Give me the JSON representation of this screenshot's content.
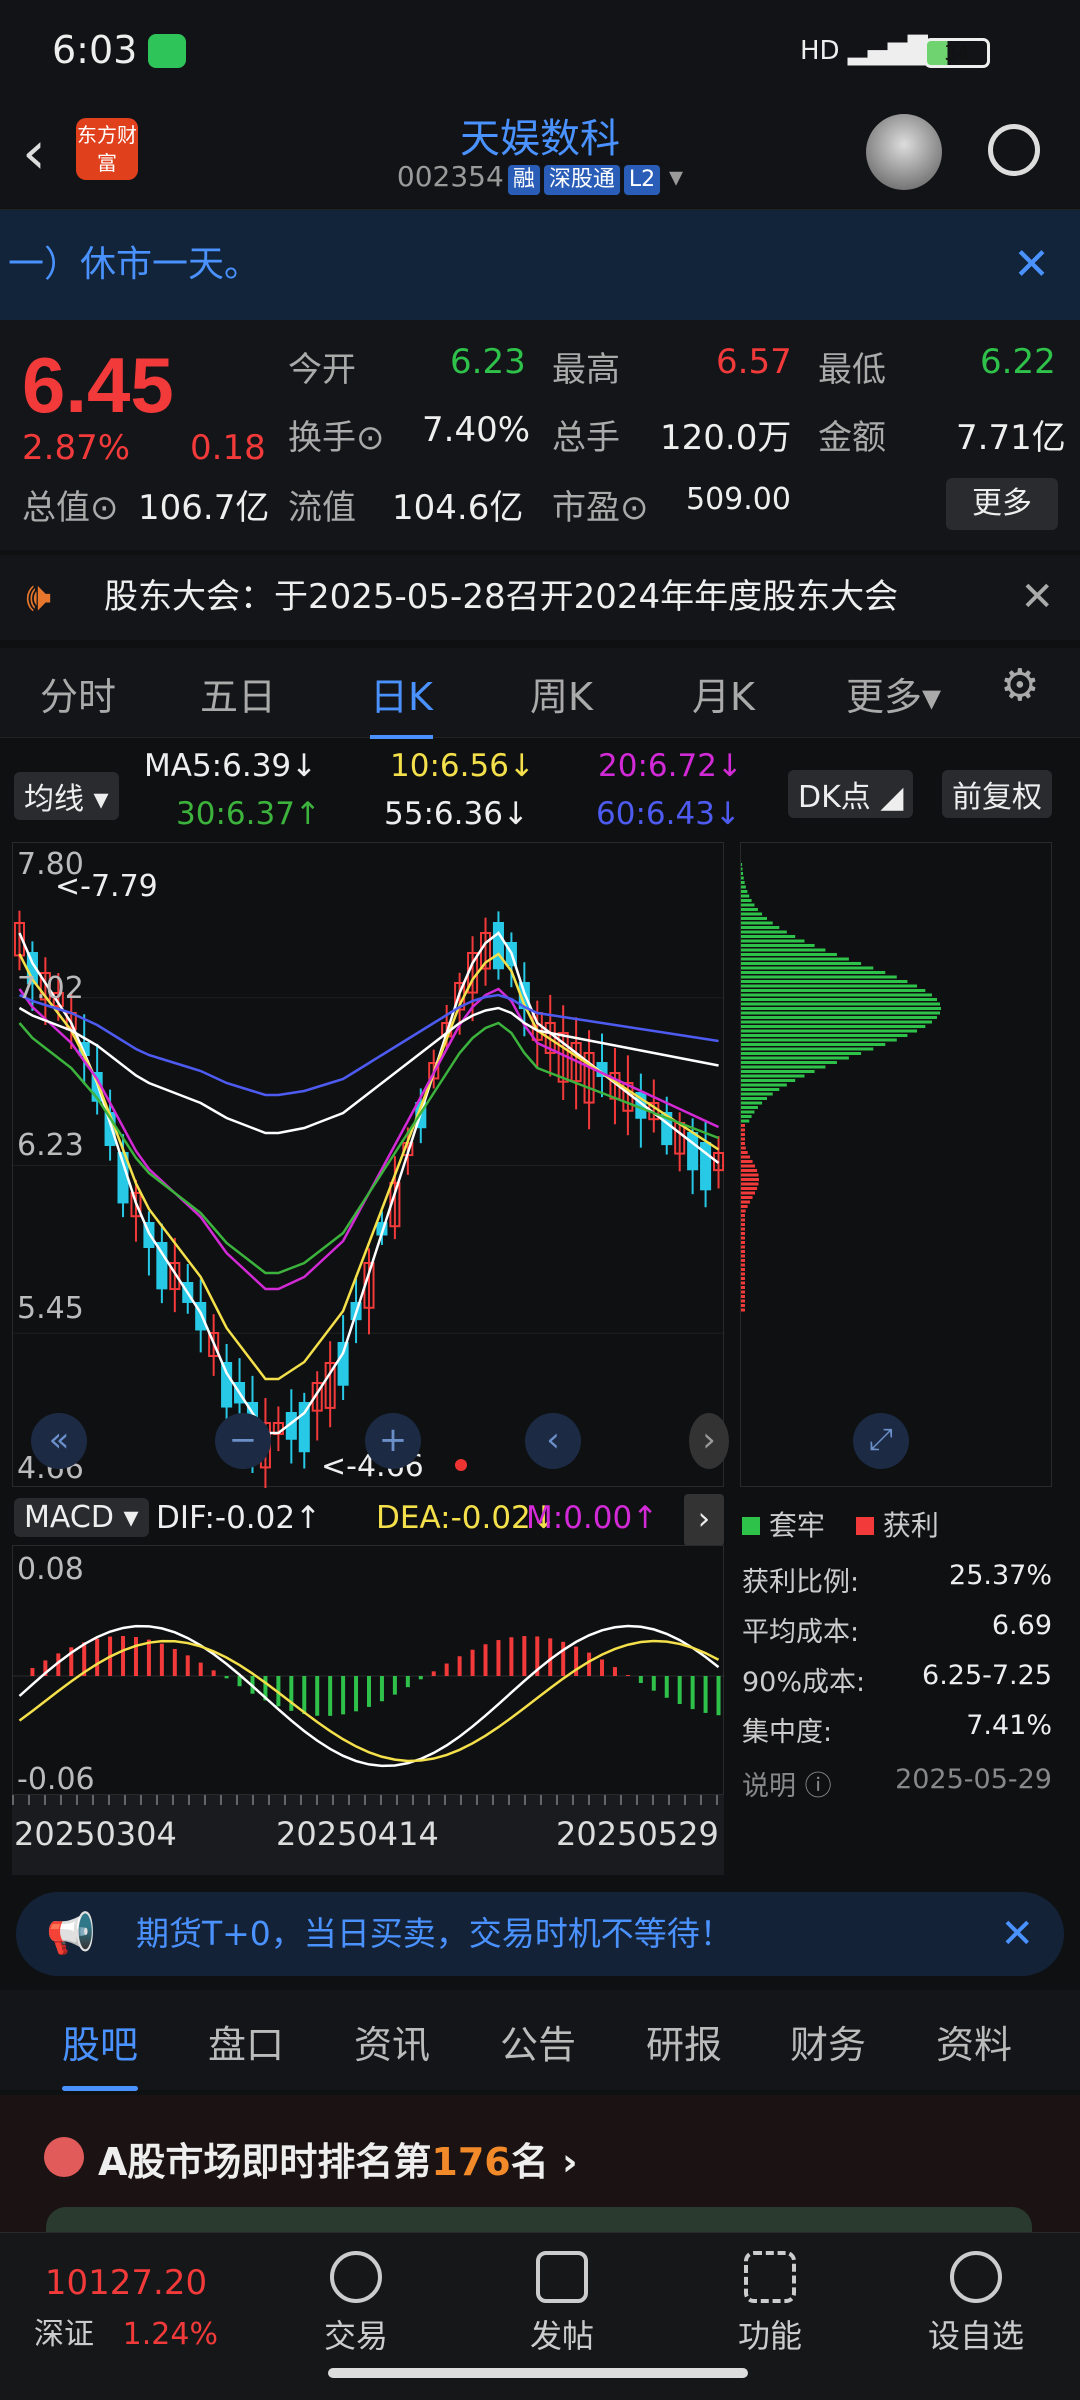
{
  "status": {
    "time": "6:03",
    "battery": "34",
    "signal": "HD"
  },
  "header": {
    "name": "天娱数科",
    "code": "002354",
    "tags": [
      "融",
      "深股通",
      "L2"
    ],
    "logo": "东方财富"
  },
  "notice": {
    "text": "一）休市一天。"
  },
  "quote": {
    "price": "6.45",
    "pct": "2.87%",
    "chg": "0.18",
    "rows": [
      [
        {
          "l": "今开",
          "v": "6.23",
          "c": "grn"
        },
        {
          "l": "最高",
          "v": "6.57",
          "c": "red"
        },
        {
          "l": "最低",
          "v": "6.22",
          "c": "grn"
        }
      ],
      [
        {
          "l": "换手",
          "v": "7.40%",
          "c": "wht"
        },
        {
          "l": "总手",
          "v": "120.0万",
          "c": "wht"
        },
        {
          "l": "金额",
          "v": "7.71亿",
          "c": "wht"
        }
      ]
    ],
    "total_value_label": "总值",
    "total_value": "106.7亿",
    "float_label": "流值",
    "float_value": "104.6亿",
    "pe_label": "市盈",
    "pe_value": "509.00",
    "more": "更多"
  },
  "meeting": {
    "text": "股东大会：于2025-05-28召开2024年年度股东大会"
  },
  "tabs": [
    "分时",
    "五日",
    "日K",
    "周K",
    "月K",
    "更多"
  ],
  "ma": {
    "toggle": "均线",
    "ma5": "MA5:6.39↓",
    "ma10": "10:6.56↓",
    "ma20": "20:6.72↓",
    "ma30": "30:6.37↑",
    "ma55": "55:6.36↓",
    "ma60": "60:6.43↓",
    "dk": "DK点",
    "fq": "前复权"
  },
  "kchart": {
    "yticks": [
      "7.80",
      "7.02",
      "6.23",
      "5.45",
      "4.66"
    ],
    "hi": "<-7.79",
    "lo": "<-4.66",
    "colors": {
      "ma5": "#ffffff",
      "ma10": "#f4e04a",
      "ma20": "#d22ad6",
      "ma30": "#3cb33c",
      "ma55": "#ffffff",
      "ma60": "#4d5bf0"
    }
  },
  "dist": {
    "legend_trapped": "套牢",
    "legend_profit": "获利"
  },
  "macd": {
    "label": "MACD",
    "dif": "DIF:-0.02↑",
    "dea": "DEA:-0.02↓",
    "m": "M:0.00↑",
    "top": "0.08",
    "bot": "-0.06"
  },
  "dates": [
    "20250304",
    "20250414",
    "20250529"
  ],
  "stats": {
    "rows": [
      {
        "l": "获利比例:",
        "v": "25.37%"
      },
      {
        "l": "平均成本:",
        "v": "6.69"
      },
      {
        "l": "90%成本:",
        "v": "6.25-7.25"
      },
      {
        "l": "集中度:",
        "v": "7.41%"
      }
    ],
    "note": "说明",
    "date": "2025-05-29"
  },
  "ad": {
    "text": "期货T+0，当日买卖，交易时机不等待！"
  },
  "subtabs": [
    "股吧",
    "盘口",
    "资讯",
    "公告",
    "研报",
    "财务",
    "资料"
  ],
  "rank": {
    "prefix": "A股市场即时排名第",
    "num": "176",
    "suffix": "名"
  },
  "bottom": {
    "index_value": "10127.20",
    "index_name": "深证",
    "index_pct": "1.24%",
    "items": [
      "交易",
      "发帖",
      "功能",
      "设自选"
    ]
  }
}
